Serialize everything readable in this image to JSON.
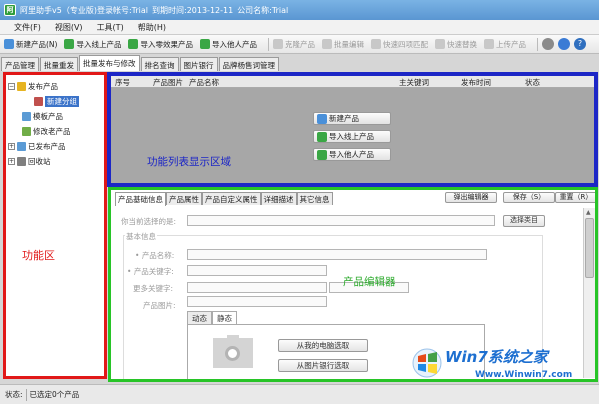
{
  "window": {
    "app_name": "阿里助手v5（专业版)登录帐号:Trial",
    "expiry": "到期时间:2013-12-11",
    "company": "公司名称:Trial"
  },
  "menu": [
    "文件(F)",
    "视图(V)",
    "工具(T)",
    "帮助(H)"
  ],
  "toolbar": {
    "buttons": [
      {
        "label": "新建产品(N)",
        "icon": "new-product-icon",
        "color": "#4a90d9",
        "enabled": true
      },
      {
        "label": "导入线上产品",
        "icon": "import-online-icon",
        "color": "#3aa745",
        "enabled": true
      },
      {
        "label": "导入零效果产品",
        "icon": "import-zero-effect-icon",
        "color": "#3aa745",
        "enabled": true
      },
      {
        "label": "导入他人产品",
        "icon": "import-others-icon",
        "color": "#3aa745",
        "enabled": true
      },
      {
        "label": "克隆产品",
        "icon": "clone-icon",
        "color": "#bdbdbd",
        "enabled": false
      },
      {
        "label": "批量编辑",
        "icon": "batch-edit-icon",
        "color": "#bdbdbd",
        "enabled": false
      },
      {
        "label": "快速四项匹配",
        "icon": "quick-match-icon",
        "color": "#bdbdbd",
        "enabled": false
      },
      {
        "label": "快速替换",
        "icon": "quick-replace-icon",
        "color": "#bdbdbd",
        "enabled": false
      },
      {
        "label": "上传产品",
        "icon": "upload-icon",
        "color": "#bdbdbd",
        "enabled": false
      }
    ]
  },
  "main_tabs": [
    "产品管理",
    "批量重发",
    "批量发布与修改",
    "排名查询",
    "图片银行",
    "品牌杨售词管理"
  ],
  "active_main_tab": 2,
  "tree": {
    "items": [
      {
        "label": "发布产品",
        "level": 0,
        "expander": "-",
        "icon": "folder-icon",
        "color": "#e6b422"
      },
      {
        "label": "新建分组",
        "level": 1,
        "selected": true,
        "icon": "group-icon",
        "color": "#c0504d"
      },
      {
        "label": "模板产品",
        "level": 0,
        "icon": "template-icon",
        "color": "#5b9bd5"
      },
      {
        "label": "修改老产品",
        "level": 0,
        "icon": "edit-icon",
        "color": "#70ad47"
      },
      {
        "label": "已发布产品",
        "level": 0,
        "expander": "+",
        "icon": "published-icon",
        "color": "#5b9bd5"
      },
      {
        "label": "回收站",
        "level": 0,
        "expander": "+",
        "icon": "recycle-icon",
        "color": "#7f7f7f"
      }
    ]
  },
  "zone_labels": {
    "function_area": "功能区",
    "list_area": "功能列表显示区域",
    "editor": "产品编辑器"
  },
  "list": {
    "columns": [
      "序号",
      "产品图片",
      "产品名称",
      "主关键词",
      "发布时间",
      "状态"
    ],
    "buttons": [
      "新建产品",
      "导入线上产品",
      "导入他人产品"
    ]
  },
  "editor": {
    "tabs": [
      "产品基础信息",
      "产品属性",
      "产品自定义属性",
      "详细描述",
      "其它信息"
    ],
    "active_tab": 0,
    "buttons": {
      "popup": "弹出编辑器",
      "save": "保存（S）",
      "reset": "重置（R）"
    },
    "selected_category_label": "你当前选择的是:",
    "choose_category": "选择类目",
    "basic_info": "基本信息",
    "product_name": "产品名称:",
    "product_keyword": "产品关键字:",
    "more_keywords": "更多关键字:",
    "product_image": "产品图片:",
    "image_tabs": [
      "动态",
      "静态"
    ],
    "active_image_tab": 1,
    "from_computer": "从我的电脑选取",
    "from_bank": "从图片银行选取"
  },
  "status": {
    "label": "状态:",
    "text": "已选定0个产品"
  },
  "watermark": {
    "title": "Win7系统之家",
    "url": "Www.Winwin7.com"
  }
}
